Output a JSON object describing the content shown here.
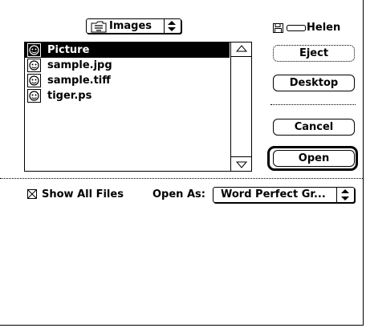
{
  "folder_popup": {
    "label": "Images",
    "icon": "folder-icon"
  },
  "files": [
    {
      "name": "Picture",
      "selected": true
    },
    {
      "name": "sample.jpg",
      "selected": false
    },
    {
      "name": "sample.tiff",
      "selected": false
    },
    {
      "name": "tiger.ps",
      "selected": false
    }
  ],
  "disk": {
    "name": "Helen"
  },
  "buttons": {
    "eject": "Eject",
    "desktop": "Desktop",
    "cancel": "Cancel",
    "open": "Open"
  },
  "show_all_files": {
    "label": "Show All Files",
    "checked": true
  },
  "open_as": {
    "label": "Open As:",
    "value": "Word Perfect Gr..."
  }
}
